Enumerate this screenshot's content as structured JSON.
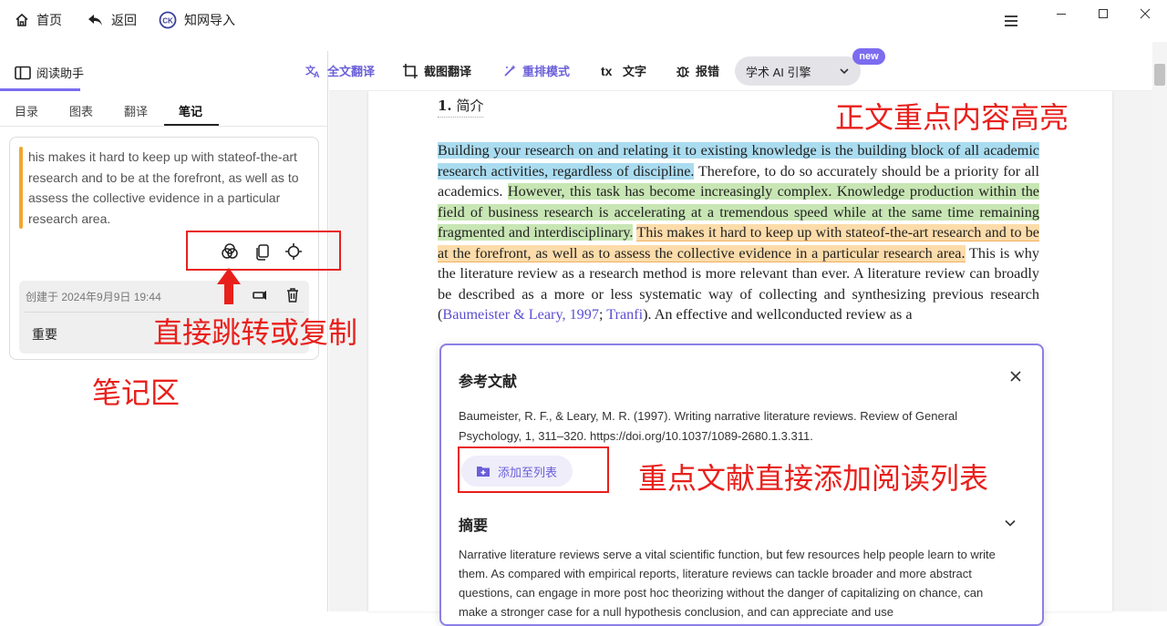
{
  "topbar": {
    "home_label": "首页",
    "back_label": "返回",
    "cnki_label": "知网导入"
  },
  "toolbar": {
    "assistant_label": "阅读助手",
    "full_translate": "全文翻译",
    "screenshot_translate": "截图翻译",
    "reflow_mode": "重排模式",
    "text_label": "文字",
    "report_error": "报错",
    "ai_engine": "学术 AI 引擎",
    "new_badge": "new"
  },
  "sidebar": {
    "tabs": [
      {
        "label": "目录"
      },
      {
        "label": "图表"
      },
      {
        "label": "翻译"
      },
      {
        "label": "笔记"
      }
    ],
    "active_tab": "笔记",
    "note": {
      "text": "his makes it hard to keep up with stateof-the-art research and to be at the forefront, as well as to assess the collective evidence in a particular research area.",
      "created": "创建于 2024年9月9日 19:44",
      "tag": "重要"
    }
  },
  "annotations": {
    "highlight": "正文重点内容高亮",
    "jump_copy": "直接跳转或复制",
    "notes_area": "笔记区",
    "add_reading_list": "重点文献直接添加阅读列表"
  },
  "document": {
    "section_number": "1.",
    "section_title": "简介",
    "p_blue": "Building your research on and relating it to existing knowledge is the building block of all academic research activities, regardless of discipline.",
    "p_plain1": " Therefore, to do so accurately should be a priority for all academics. ",
    "p_green": "However, this task has become increasingly complex. Knowledge production within the field of business research is accelerating at a tremendous speed while at the same time remaining fragmented and interdisciplinary.",
    "p_space": " ",
    "p_orange": "This makes it hard to keep up with stateof-the-art research and to be at the forefront, as well as to assess the collective evidence in a particular research area.",
    "p_plain2": " This is why the literature review as a research method is more relevant than ever. A literature review can broadly be described as a more or less systematic way of collecting and synthesizing previous research (",
    "link1": "Baumeister & Leary, 1997",
    "p_sep": "; ",
    "link2": "Tranfi",
    "p_plain3": "). An effective and wellconducted review as a"
  },
  "reference": {
    "title": "参考文献",
    "citation": "Baumeister, R. F., & Leary, M. R. (1997). Writing narrative literature reviews. Review of General Psychology, 1, 311–320. https://doi.org/10.1037/1089-2680.1.3.311.",
    "add_button": "添加至列表",
    "abstract_title": "摘要",
    "abstract": "Narrative literature reviews serve a vital scientific function, but few resources help people learn to write them. As compared with empirical reports, literature reviews can tackle broader and more abstract questions, can engage in more post hoc theorizing without the danger of capitalizing on chance, can make a stronger case for a null hypothesis conclusion, and can appreciate and use"
  },
  "colors": {
    "accent": "#7b6cf0",
    "annotation_red": "#e8201c",
    "highlight_blue": "#aadcf0",
    "highlight_green": "#c8e6b4",
    "highlight_orange": "#fcdcaa",
    "note_bar": "#f0a830"
  }
}
